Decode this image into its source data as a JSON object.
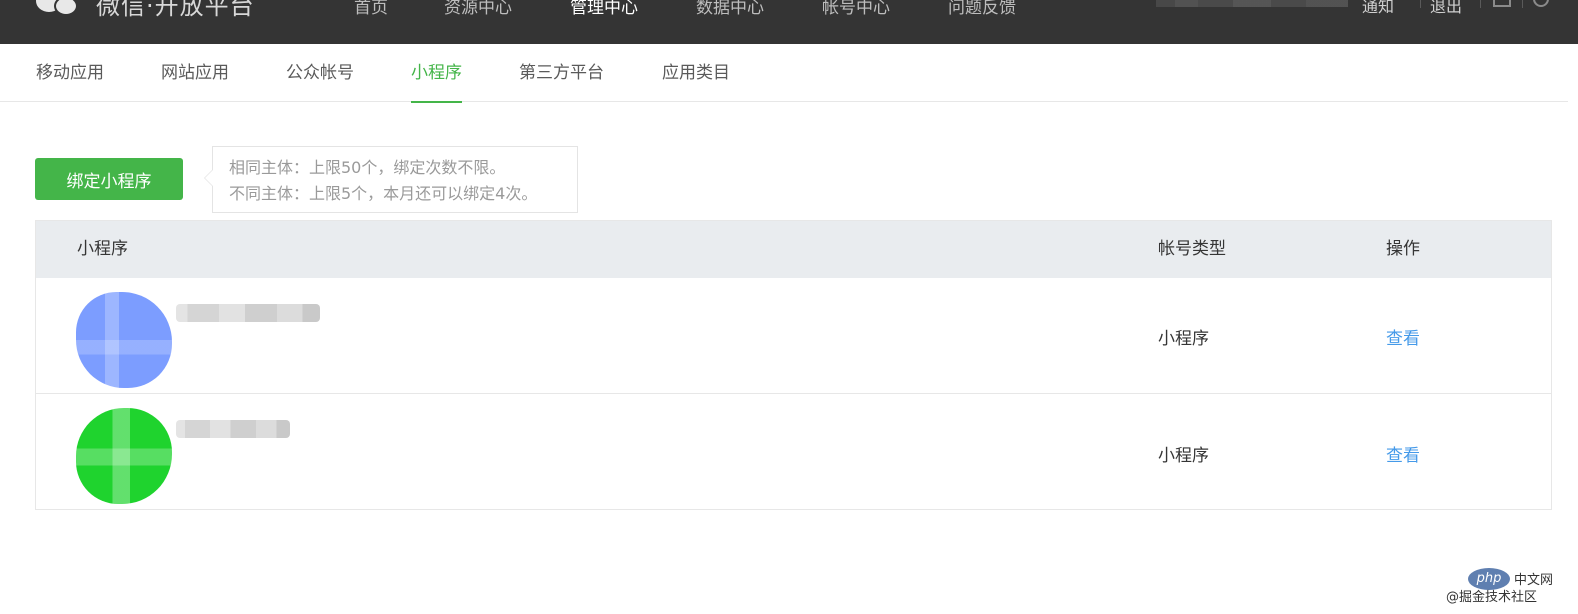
{
  "topbar": {
    "brand": "微信·开放平台",
    "nav": [
      "首页",
      "资源中心",
      "管理中心",
      "数据中心",
      "帐号中心",
      "问题反馈"
    ],
    "active_nav": "管理中心",
    "notify_label": "通知",
    "logout_label": "退出"
  },
  "subnav": {
    "tabs": [
      "移动应用",
      "网站应用",
      "公众帐号",
      "小程序",
      "第三方平台",
      "应用类目"
    ],
    "active_tab": "小程序"
  },
  "bind": {
    "button_label": "绑定小程序",
    "tip_line1": "相同主体：上限50个，绑定次数不限。",
    "tip_line2": "不同主体：上限5个，本月还可以绑定4次。"
  },
  "table": {
    "headers": [
      "小程序",
      "帐号类型",
      "操作"
    ],
    "rows": [
      {
        "type": "小程序",
        "action": "查看"
      },
      {
        "type": "小程序",
        "action": "查看"
      }
    ]
  },
  "watermark": {
    "logo": "php",
    "site": "中文网",
    "sub": "@掘金技术社区"
  },
  "colors": {
    "accent": "#44b549",
    "link": "#459ae9",
    "topbar_bg": "#343434",
    "header_bg": "#e9ecef"
  }
}
